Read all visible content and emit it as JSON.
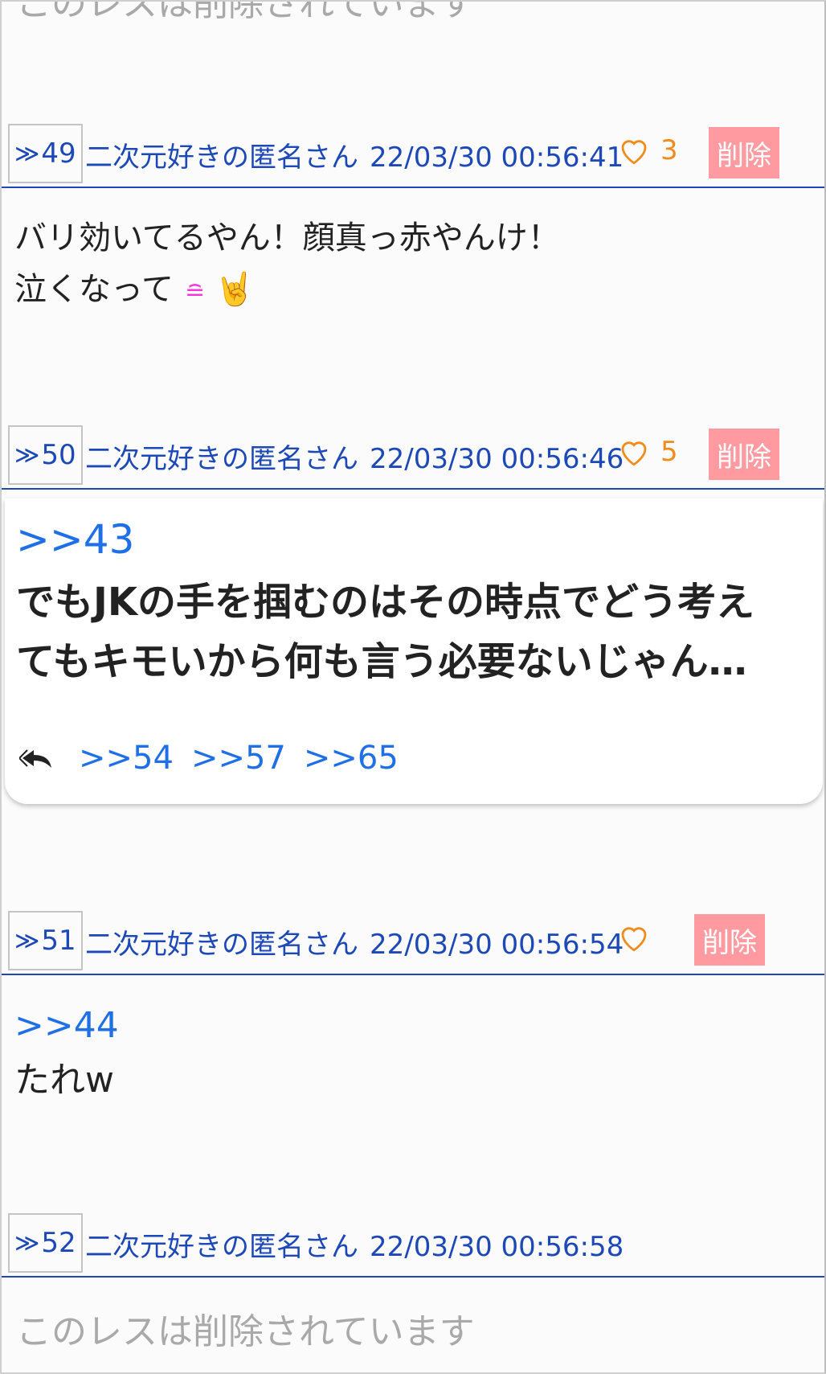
{
  "top_deleted": "このレスは削除されています",
  "posts": [
    {
      "number": "49",
      "name": "二次元好きの匿名さん",
      "date": "22/03/30 00:56:41",
      "likes": "3",
      "delete_label": "削除",
      "lines": [
        "バリ効いてるやん！顔真っ赤やんけ！",
        "泣くなって"
      ],
      "emoji_face": "≘",
      "emoji_hand": "🤘"
    },
    {
      "number": "50",
      "name": "二次元好きの匿名さん",
      "date": "22/03/30 00:56:46",
      "likes": "5",
      "delete_label": "削除",
      "anchor": ">>43",
      "lines": [
        "でもJKの手を掴むのはその時点でどう考え",
        "てもキモいから何も言う必要ないじゃん…"
      ],
      "replies": [
        ">>54",
        ">>57",
        ">>65"
      ]
    },
    {
      "number": "51",
      "name": "二次元好きの匿名さん",
      "date": "22/03/30 00:56:54",
      "likes": "",
      "delete_label": "削除",
      "anchor": ">>44",
      "lines": [
        "たれw"
      ]
    },
    {
      "number": "52",
      "name": "二次元好きの匿名さん",
      "date": "22/03/30 00:56:58",
      "deleted": "このレスは削除されています"
    }
  ],
  "icons": {
    "like": "heart-outline-icon",
    "reply": "reply-icon",
    "arrow": "double-chevron-right-icon"
  },
  "colors": {
    "link": "#1c48b8",
    "anchor": "#1f6fe6",
    "like": "#f08c1e",
    "delete_bg": "#ff9aa0",
    "deleted_text": "#a9a9a9"
  }
}
